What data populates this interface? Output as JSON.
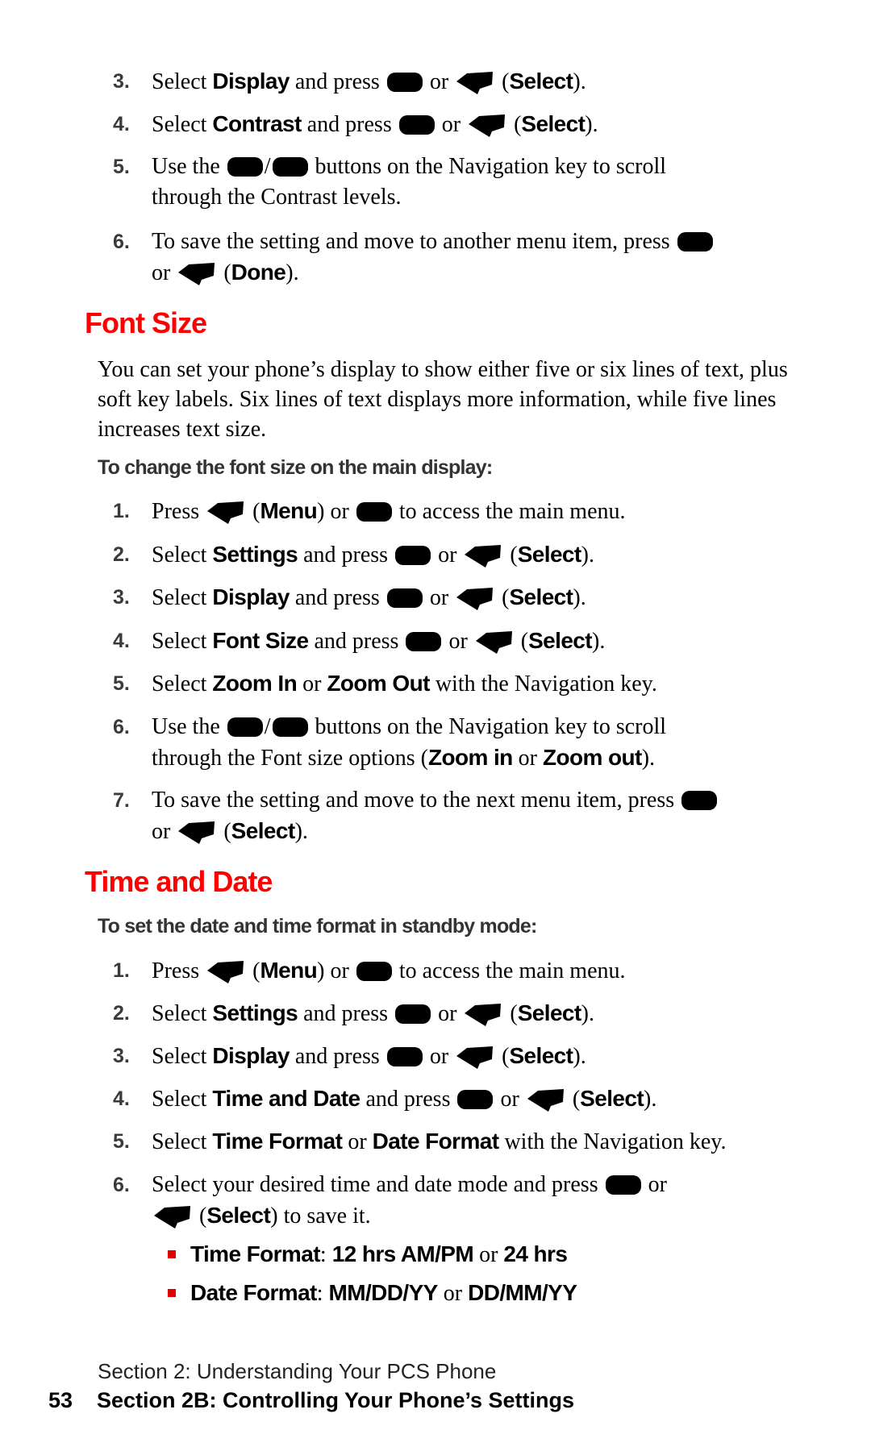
{
  "icons": {
    "center_key": "center-select-key-icon",
    "soft_key": "soft-key-icon"
  },
  "colors": {
    "heading": "#ff0000",
    "bullet": "#e00000"
  },
  "common": {
    "select": "Select",
    "and_press": "and press",
    "or": "or",
    "menu": "Menu",
    "done": "Done"
  },
  "contrast_steps": [
    {
      "num": "3.",
      "pre": "Select",
      "bold": "Display"
    },
    {
      "num": "4.",
      "pre": "Select",
      "bold": "Contrast"
    },
    {
      "num": "5.",
      "line1_pre": "Use the",
      "line1_post": "buttons on the Navigation key to scroll",
      "line2": "through the Contrast levels."
    },
    {
      "num": "6.",
      "line1": "To save the setting and move to another menu item, press",
      "line2_post": "(Done)."
    }
  ],
  "font_size": {
    "heading": "Font Size",
    "paragraph": "You can set your phone’s display to show either five or six lines of text, plus soft key labels. Six lines of text displays more information, while five lines increases text size.",
    "subhead": "To change the font size on the main display:",
    "steps": [
      {
        "num": "1.",
        "pre": "Press",
        "post": "to access the main menu."
      },
      {
        "num": "2.",
        "pre": "Select",
        "bold": "Settings"
      },
      {
        "num": "3.",
        "pre": "Select",
        "bold": "Display"
      },
      {
        "num": "4.",
        "pre": "Select",
        "bold": "Font Size"
      },
      {
        "num": "5.",
        "pre": "Select",
        "bold1": "Zoom In",
        "mid": "or",
        "bold2": "Zoom Out",
        "post": "with the Navigation key."
      },
      {
        "num": "6.",
        "line1_pre": "Use the",
        "line1_post": "buttons on the Navigation key to scroll",
        "line2_pre": "through the Font size options (",
        "bold1": "Zoom in",
        "mid": "or",
        "bold2": "Zoom out",
        "line2_post": ")."
      },
      {
        "num": "7.",
        "line1": "To save the setting and move to the next menu item, press"
      }
    ]
  },
  "time_date": {
    "heading": "Time and Date",
    "subhead": "To set the date and time format in standby mode:",
    "steps": [
      {
        "num": "1.",
        "pre": "Press",
        "post": "to access the main menu."
      },
      {
        "num": "2.",
        "pre": "Select",
        "bold": "Settings"
      },
      {
        "num": "3.",
        "pre": "Select",
        "bold": "Display"
      },
      {
        "num": "4.",
        "pre": "Select",
        "bold": "Time and Date"
      },
      {
        "num": "5.",
        "pre": "Select",
        "bold1": "Time Format",
        "mid": "or",
        "bold2": "Date Format",
        "post": "with the Navigation key."
      },
      {
        "num": "6.",
        "line1": "Select your desired time and date mode and press",
        "line2_post": "to save it."
      }
    ],
    "bullets": [
      {
        "label": "Time Format",
        "opt1": "12 hrs AM/PM",
        "mid": "or",
        "opt2": "24 hrs"
      },
      {
        "label": "Date Format",
        "opt1": "MM/DD/YY",
        "mid": "or",
        "opt2": "DD/MM/YY"
      }
    ]
  },
  "footer": {
    "section": "Section 2: Understanding Your PCS Phone",
    "page_number": "53",
    "chapter": "Section 2B: Controlling Your Phone’s Settings"
  }
}
